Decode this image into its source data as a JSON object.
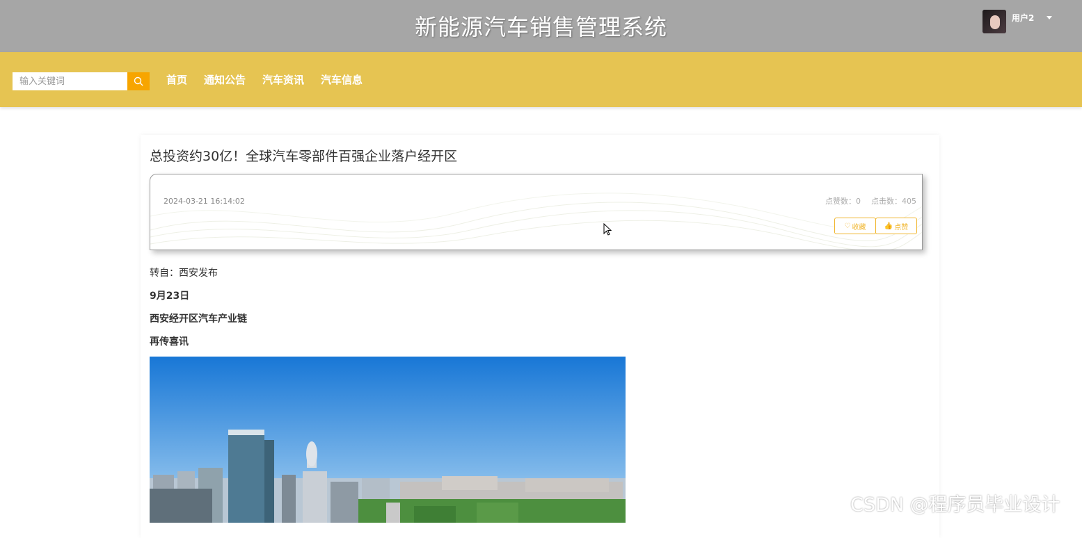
{
  "header": {
    "title": "新能源汽车销售管理系统",
    "user": {
      "name": "用户2"
    }
  },
  "nav": {
    "search": {
      "placeholder": "输入关键词",
      "value": ""
    },
    "items": [
      {
        "label": "首页"
      },
      {
        "label": "通知公告"
      },
      {
        "label": "汽车资讯"
      },
      {
        "label": "汽车信息"
      }
    ]
  },
  "article": {
    "title": "总投资约30亿！全球汽车零部件百强企业落户经开区",
    "date": "2024-03-21 16:14:02",
    "likes_text": "点赞数：0",
    "clicks_text": "点击数：405",
    "favorite_label": "收藏",
    "like_label": "点赞",
    "paragraphs": [
      "转自：西安发布",
      "9月23日",
      "西安经开区汽车产业链",
      "再传喜讯"
    ]
  },
  "watermark": "CSDN @程序员毕业设计",
  "colors": {
    "topbar": "#a6a6a6",
    "navbar": "#e6c452",
    "accent": "#f7a500",
    "button_border": "#f0b429"
  },
  "icons": [
    "search-icon",
    "caret-down-icon",
    "heart-icon",
    "thumbs-up-icon",
    "cursor-icon"
  ]
}
